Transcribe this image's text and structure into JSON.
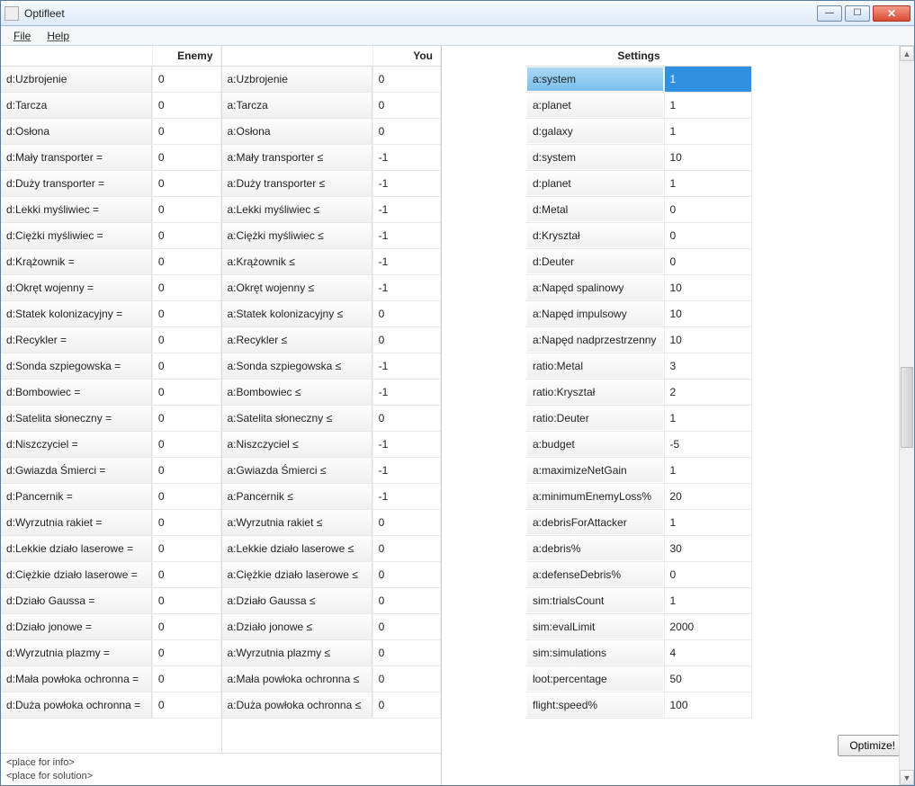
{
  "window": {
    "title": "Optifleet"
  },
  "menubar": {
    "file": "File",
    "help": "Help"
  },
  "headers": {
    "enemy": "Enemy",
    "you": "You",
    "settings": "Settings"
  },
  "enemy_rows": [
    {
      "label": "d:Uzbrojenie",
      "value": "0"
    },
    {
      "label": "d:Tarcza",
      "value": "0"
    },
    {
      "label": "d:Osłona",
      "value": "0"
    },
    {
      "label": "d:Mały transporter =",
      "value": "0"
    },
    {
      "label": "d:Duży transporter =",
      "value": "0"
    },
    {
      "label": "d:Lekki myśliwiec =",
      "value": "0"
    },
    {
      "label": "d:Ciężki myśliwiec =",
      "value": "0"
    },
    {
      "label": "d:Krążownik =",
      "value": "0"
    },
    {
      "label": "d:Okręt wojenny =",
      "value": "0"
    },
    {
      "label": "d:Statek kolonizacyjny =",
      "value": "0"
    },
    {
      "label": "d:Recykler =",
      "value": "0"
    },
    {
      "label": "d:Sonda szpiegowska =",
      "value": "0"
    },
    {
      "label": "d:Bombowiec =",
      "value": "0"
    },
    {
      "label": "d:Satelita słoneczny =",
      "value": "0"
    },
    {
      "label": "d:Niszczyciel =",
      "value": "0"
    },
    {
      "label": "d:Gwiazda Śmierci =",
      "value": "0"
    },
    {
      "label": "d:Pancernik =",
      "value": "0"
    },
    {
      "label": "d:Wyrzutnia rakiet =",
      "value": "0"
    },
    {
      "label": "d:Lekkie działo laserowe =",
      "value": "0"
    },
    {
      "label": "d:Ciężkie działo laserowe =",
      "value": "0"
    },
    {
      "label": "d:Działo Gaussa =",
      "value": "0"
    },
    {
      "label": "d:Działo jonowe =",
      "value": "0"
    },
    {
      "label": "d:Wyrzutnia plazmy =",
      "value": "0"
    },
    {
      "label": "d:Mała powłoka ochronna =",
      "value": "0"
    },
    {
      "label": "d:Duża powłoka ochronna =",
      "value": "0"
    }
  ],
  "you_rows": [
    {
      "label": "a:Uzbrojenie",
      "value": "0"
    },
    {
      "label": "a:Tarcza",
      "value": "0"
    },
    {
      "label": "a:Osłona",
      "value": "0"
    },
    {
      "label": "a:Mały transporter ≤",
      "value": "-1"
    },
    {
      "label": "a:Duży transporter ≤",
      "value": "-1"
    },
    {
      "label": "a:Lekki myśliwiec ≤",
      "value": "-1"
    },
    {
      "label": "a:Ciężki myśliwiec ≤",
      "value": "-1"
    },
    {
      "label": "a:Krążownik ≤",
      "value": "-1"
    },
    {
      "label": "a:Okręt wojenny ≤",
      "value": "-1"
    },
    {
      "label": "a:Statek kolonizacyjny ≤",
      "value": "0"
    },
    {
      "label": "a:Recykler ≤",
      "value": "0"
    },
    {
      "label": "a:Sonda szpiegowska ≤",
      "value": "-1"
    },
    {
      "label": "a:Bombowiec ≤",
      "value": "-1"
    },
    {
      "label": "a:Satelita słoneczny ≤",
      "value": "0"
    },
    {
      "label": "a:Niszczyciel ≤",
      "value": "-1"
    },
    {
      "label": "a:Gwiazda Śmierci ≤",
      "value": "-1"
    },
    {
      "label": "a:Pancernik ≤",
      "value": "-1"
    },
    {
      "label": "a:Wyrzutnia rakiet ≤",
      "value": "0"
    },
    {
      "label": "a:Lekkie działo laserowe ≤",
      "value": "0"
    },
    {
      "label": "a:Ciężkie działo laserowe ≤",
      "value": "0"
    },
    {
      "label": "a:Działo Gaussa ≤",
      "value": "0"
    },
    {
      "label": "a:Działo jonowe ≤",
      "value": "0"
    },
    {
      "label": "a:Wyrzutnia plazmy ≤",
      "value": "0"
    },
    {
      "label": "a:Mała powłoka ochronna ≤",
      "value": "0"
    },
    {
      "label": "a:Duża powłoka ochronna ≤",
      "value": "0"
    }
  ],
  "settings_rows": [
    {
      "label": "a:system",
      "value": "1",
      "selected": true
    },
    {
      "label": "a:planet",
      "value": "1"
    },
    {
      "label": "d:galaxy",
      "value": "1"
    },
    {
      "label": "d:system",
      "value": "10"
    },
    {
      "label": "d:planet",
      "value": "1"
    },
    {
      "label": "d:Metal",
      "value": "0"
    },
    {
      "label": "d:Kryształ",
      "value": "0"
    },
    {
      "label": "d:Deuter",
      "value": "0"
    },
    {
      "label": "a:Napęd spalinowy",
      "value": "10"
    },
    {
      "label": "a:Napęd impulsowy",
      "value": "10"
    },
    {
      "label": "a:Napęd nadprzestrzenny",
      "value": "10"
    },
    {
      "label": "ratio:Metal",
      "value": "3"
    },
    {
      "label": "ratio:Kryształ",
      "value": "2"
    },
    {
      "label": "ratio:Deuter",
      "value": "1"
    },
    {
      "label": "a:budget",
      "value": "-5"
    },
    {
      "label": "a:maximizeNetGain",
      "value": "1"
    },
    {
      "label": "a:minimumEnemyLoss%",
      "value": "20"
    },
    {
      "label": "a:debrisForAttacker",
      "value": "1"
    },
    {
      "label": "a:debris%",
      "value": "30"
    },
    {
      "label": "a:defenseDebris%",
      "value": "0"
    },
    {
      "label": "sim:trialsCount",
      "value": "1"
    },
    {
      "label": "sim:evalLimit",
      "value": "2000"
    },
    {
      "label": "sim:simulations",
      "value": "4"
    },
    {
      "label": "loot:percentage",
      "value": "50"
    },
    {
      "label": "flight:speed%",
      "value": "100"
    }
  ],
  "status": {
    "info": "<place for info>",
    "solution": "<place for solution>"
  },
  "buttons": {
    "optimize": "Optimize!"
  }
}
